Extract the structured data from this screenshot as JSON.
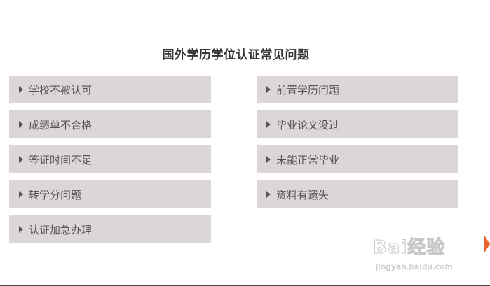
{
  "page": {
    "title": "国外学历学位认证常见问题"
  },
  "left_items": [
    {
      "label": "学校不被认可"
    },
    {
      "label": "成绩单不合格"
    },
    {
      "label": "签证时间不足"
    },
    {
      "label": "转学分问题"
    },
    {
      "label": "认证加急办理"
    }
  ],
  "right_items": [
    {
      "label": "前置学历问题"
    },
    {
      "label": "毕业论文没过"
    },
    {
      "label": "未能正常毕业"
    },
    {
      "label": "资料有遗失"
    }
  ],
  "watermark": {
    "brand": "Bai经验",
    "url": "jingyan.baidu.com"
  },
  "colors": {
    "item_bg": "#dcd6d6",
    "text": "#555555",
    "title": "#333333",
    "accent": "#e8622c"
  }
}
